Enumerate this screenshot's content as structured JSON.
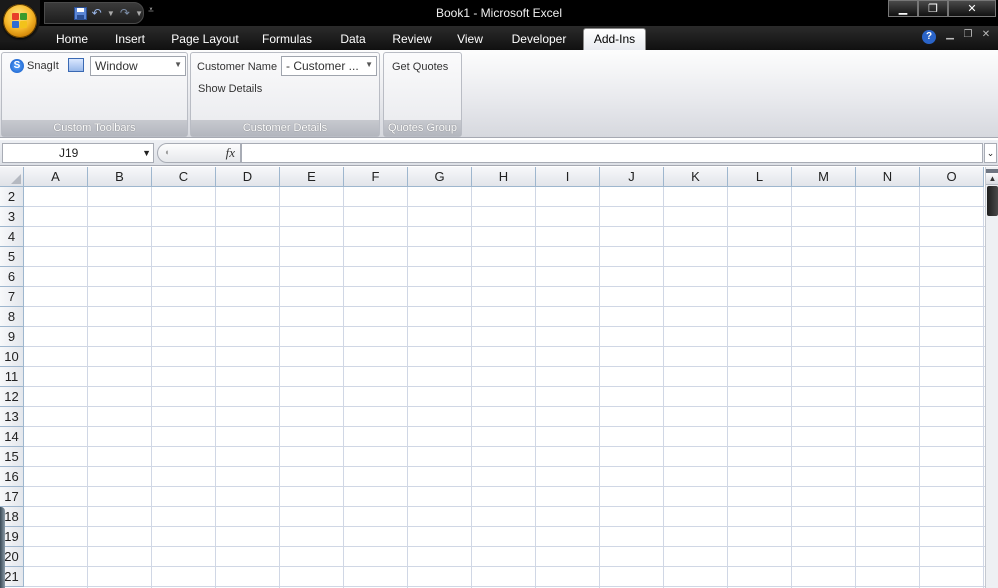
{
  "window": {
    "title": "Book1 - Microsoft Excel",
    "controls": {
      "minimize": "▁",
      "restore": "❐",
      "close": "✕"
    }
  },
  "qat": {
    "customize": "⩡"
  },
  "tabs": [
    "Home",
    "Insert",
    "Page Layout",
    "Formulas",
    "Data",
    "Review",
    "View",
    "Developer",
    "Add-Ins"
  ],
  "active_tab": "Add-Ins",
  "help_label": "?",
  "ribbon": {
    "groups": [
      {
        "label": "Custom Toolbars",
        "snagit_label": "SnagIt",
        "window_combo": "Window"
      },
      {
        "label": "Customer Details",
        "customer_name_label": "Customer Name",
        "customer_combo": "- Customer ...",
        "show_details_label": "Show Details"
      },
      {
        "label": "Quotes Group",
        "get_quotes_label": "Get Quotes"
      }
    ]
  },
  "formula_bar": {
    "name_box": "J19",
    "fx_label": "fx",
    "value": ""
  },
  "grid": {
    "columns": [
      "A",
      "B",
      "C",
      "D",
      "E",
      "F",
      "G",
      "H",
      "I",
      "J",
      "K",
      "L",
      "M",
      "N",
      "O"
    ],
    "rows": [
      "2",
      "3",
      "4",
      "5",
      "6",
      "7",
      "8",
      "9",
      "10",
      "11",
      "12",
      "13",
      "14",
      "15",
      "16",
      "17",
      "18",
      "19",
      "20",
      "21"
    ]
  },
  "colors": {
    "title_bg": "#000000",
    "tab_bar_bg": "#1a1a1a",
    "gridline": "#d0d7e5",
    "header_border": "#9eb6ce"
  }
}
